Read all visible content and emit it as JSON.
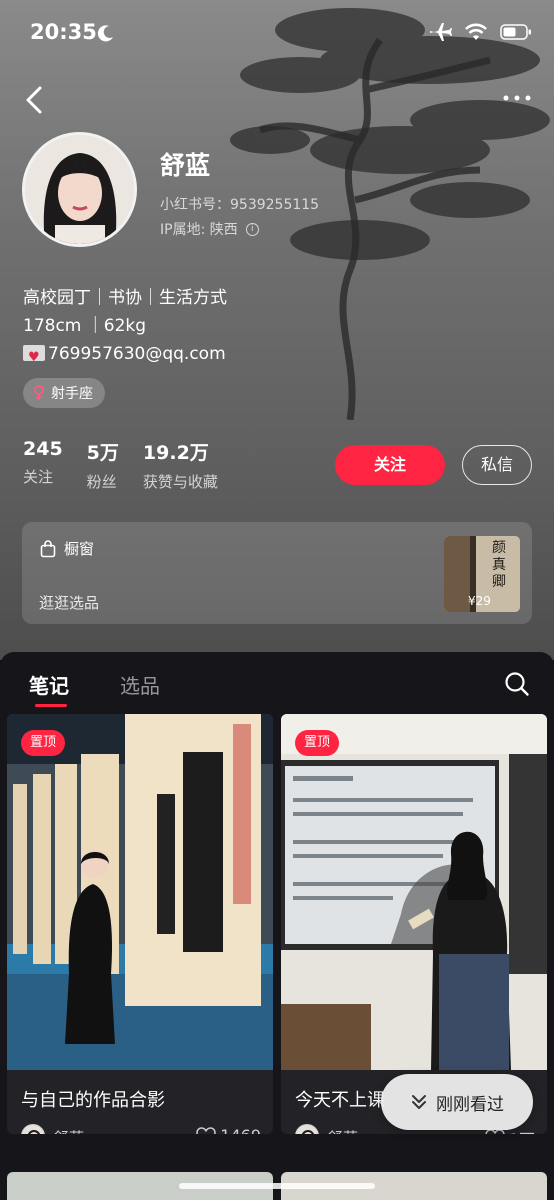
{
  "status_bar": {
    "time": "20:35"
  },
  "profile": {
    "nickname": "舒蓝",
    "user_id": "小红书号：9539255115",
    "ip_location": "IP属地: 陕西",
    "bio_lines": [
      "高校园丁｜书协｜生活方式",
      "178cm ｜62kg",
      "769957630@qq.com"
    ],
    "tag": "射手座"
  },
  "stats": [
    {
      "num": "245",
      "label": "关注"
    },
    {
      "num": "5万",
      "label": "粉丝"
    },
    {
      "num": "19.2万",
      "label": "获赞与收藏"
    }
  ],
  "actions": {
    "follow": "关注",
    "message": "私信"
  },
  "shop": {
    "title": "橱窗",
    "subtitle": "逛逛选品",
    "price": "¥29",
    "thumb_text": "颜真卿"
  },
  "tabs": {
    "notes": "笔记",
    "picks": "选品"
  },
  "notes": [
    {
      "pin": "置顶",
      "title": "与自己的作品合影",
      "author": "舒蓝",
      "likes": "1469"
    },
    {
      "pin": "置顶",
      "title": "今天不上课",
      "author": "舒蓝",
      "likes": "1万"
    }
  ],
  "recent_button": "刚刚看过",
  "colors": {
    "accent": "#ff2442",
    "panel": "#15151a",
    "card": "#232327"
  }
}
